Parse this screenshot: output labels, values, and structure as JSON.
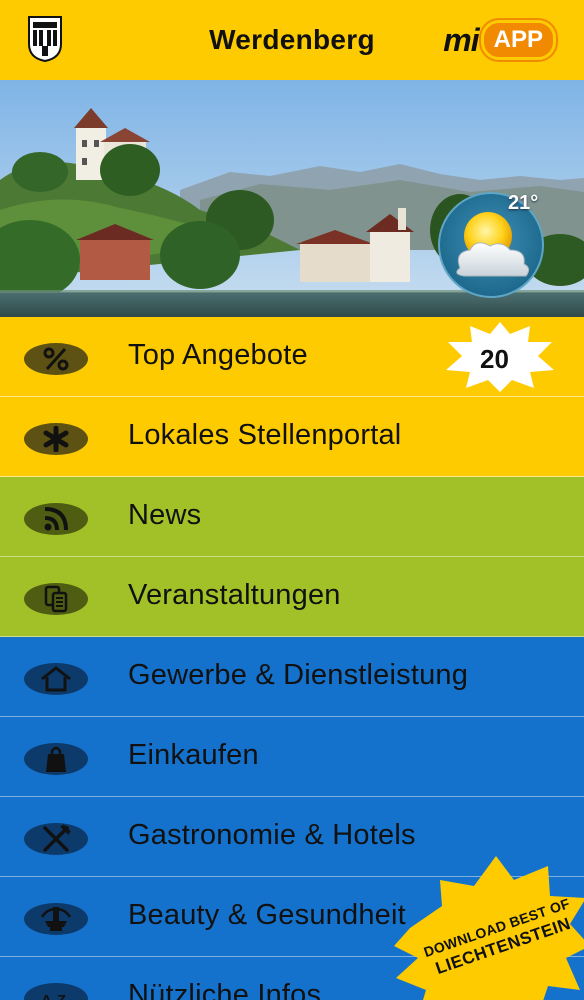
{
  "header": {
    "title": "Werdenberg",
    "brand_mi": "mi",
    "brand_app": "APP"
  },
  "weather": {
    "temperature": "21°",
    "icon": "sun-behind-cloud-icon"
  },
  "menu": [
    {
      "label": "Top Angebote",
      "icon": "percent-icon",
      "color": "#fecb00"
    },
    {
      "label": "Lokales Stellenportal",
      "icon": "asterisk-icon",
      "color": "#fecb00"
    },
    {
      "label": "News",
      "icon": "rss-feed-icon",
      "color": "#a2c128"
    },
    {
      "label": "Veranstaltungen",
      "icon": "tickets-icon",
      "color": "#a2c128"
    },
    {
      "label": "Gewerbe & Dienstleistung",
      "icon": "house-icon",
      "color": "#1572cc"
    },
    {
      "label": "Einkaufen",
      "icon": "shopping-bag-icon",
      "color": "#1572cc"
    },
    {
      "label": "Gastronomie & Hotels",
      "icon": "fork-knife-icon",
      "color": "#1572cc"
    },
    {
      "label": "Beauty & Gesundheit",
      "icon": "fountain-icon",
      "color": "#1572cc"
    },
    {
      "label": "Nützliche Infos",
      "icon": "a-z-icon",
      "color": "#1572cc"
    }
  ],
  "badge": {
    "count": "20"
  },
  "promo": {
    "line1": "DOWNLOAD BEST OF",
    "line2": "LIECHTENSTEIN"
  }
}
